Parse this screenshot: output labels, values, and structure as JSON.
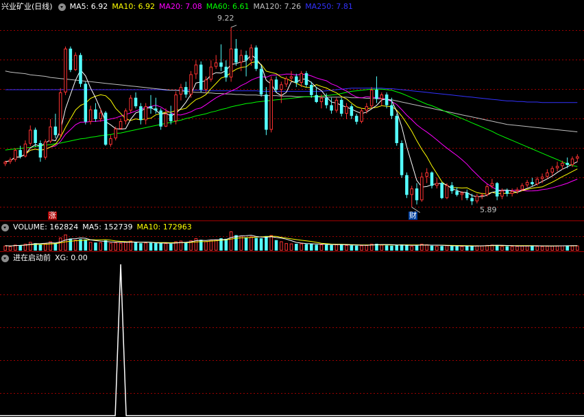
{
  "main_header": {
    "stock_name": "兴业矿业(日线)",
    "ma5": "MA5: 6.92",
    "ma10": "MA10: 6.92",
    "ma20": "MA20: 7.08",
    "ma60": "MA60: 6.61",
    "ma120": "MA120: 7.26",
    "ma250": "MA250: 7.81"
  },
  "vol_header": {
    "volume": "VOLUME: 162824",
    "ma5": "MA5: 152739",
    "ma10": "MA10: 172963"
  },
  "ind_header": {
    "name": "进在启动前",
    "xg": "XG: 0.00"
  },
  "annotations": {
    "high": "9.22",
    "low": "5.89",
    "tag_zhang": "涨",
    "tag_cai": "财"
  },
  "colors": {
    "up": "#ff3232",
    "down": "#54ffff",
    "ma5": "#ffffff",
    "ma10": "#ffff00",
    "ma20": "#ff00ff",
    "ma60": "#00ff00",
    "ma120": "#c0c0c0",
    "ma250": "#3232ff",
    "grid": "#a00000"
  },
  "chart_data": {
    "type": "candlestick",
    "ylim": [
      5.6,
      9.5
    ],
    "candles": [
      [
        6.66,
        6.72,
        6.62,
        6.7
      ],
      [
        6.7,
        6.78,
        6.66,
        6.74
      ],
      [
        6.74,
        6.95,
        6.7,
        6.92
      ],
      [
        6.92,
        7.0,
        6.76,
        6.8
      ],
      [
        6.8,
        7.1,
        6.78,
        7.04
      ],
      [
        7.04,
        7.38,
        7.0,
        7.3
      ],
      [
        7.3,
        7.34,
        6.98,
        7.05
      ],
      [
        7.05,
        7.1,
        6.7,
        6.78
      ],
      [
        6.78,
        7.12,
        6.74,
        7.08
      ],
      [
        7.08,
        7.5,
        7.05,
        7.36
      ],
      [
        7.36,
        7.6,
        7.14,
        7.2
      ],
      [
        7.2,
        8.08,
        7.15,
        8.0
      ],
      [
        8.0,
        8.86,
        7.95,
        8.82
      ],
      [
        8.82,
        8.86,
        8.38,
        8.42
      ],
      [
        8.42,
        8.75,
        8.4,
        8.7
      ],
      [
        8.7,
        8.74,
        8.1,
        8.16
      ],
      [
        8.16,
        8.2,
        7.4,
        7.45
      ],
      [
        7.45,
        7.75,
        7.4,
        7.68
      ],
      [
        7.68,
        7.8,
        7.45,
        7.5
      ],
      [
        7.5,
        7.7,
        7.45,
        7.62
      ],
      [
        7.62,
        7.65,
        7.0,
        7.02
      ],
      [
        7.02,
        7.2,
        6.98,
        7.14
      ],
      [
        7.14,
        7.36,
        7.1,
        7.32
      ],
      [
        7.32,
        7.5,
        7.3,
        7.46
      ],
      [
        7.46,
        7.7,
        7.4,
        7.66
      ],
      [
        7.66,
        7.95,
        7.62,
        7.9
      ],
      [
        7.9,
        8.0,
        7.7,
        7.74
      ],
      [
        7.74,
        7.8,
        7.4,
        7.48
      ],
      [
        7.48,
        7.8,
        7.4,
        7.74
      ],
      [
        7.74,
        7.95,
        7.6,
        7.7
      ],
      [
        7.7,
        7.9,
        7.6,
        7.66
      ],
      [
        7.66,
        7.7,
        7.3,
        7.36
      ],
      [
        7.36,
        7.7,
        7.35,
        7.6
      ],
      [
        7.6,
        7.75,
        7.4,
        7.46
      ],
      [
        7.46,
        8.02,
        7.4,
        7.96
      ],
      [
        7.96,
        8.16,
        7.85,
        8.1
      ],
      [
        8.1,
        8.2,
        7.9,
        7.96
      ],
      [
        7.96,
        8.4,
        7.9,
        8.34
      ],
      [
        8.34,
        8.6,
        8.25,
        8.52
      ],
      [
        8.52,
        8.58,
        8.0,
        8.05
      ],
      [
        8.05,
        8.3,
        8.0,
        8.24
      ],
      [
        8.24,
        8.6,
        8.2,
        8.48
      ],
      [
        8.48,
        8.7,
        8.44,
        8.56
      ],
      [
        8.56,
        8.9,
        8.4,
        8.48
      ],
      [
        8.48,
        8.6,
        8.2,
        8.28
      ],
      [
        8.28,
        9.22,
        8.2,
        8.82
      ],
      [
        8.82,
        9.0,
        8.5,
        8.56
      ],
      [
        8.56,
        8.8,
        8.4,
        8.7
      ],
      [
        8.7,
        8.78,
        8.3,
        8.6
      ],
      [
        8.6,
        8.9,
        8.5,
        8.84
      ],
      [
        8.84,
        8.88,
        8.4,
        8.44
      ],
      [
        8.44,
        8.5,
        7.92,
        7.96
      ],
      [
        7.96,
        8.1,
        7.2,
        7.3
      ],
      [
        7.3,
        8.3,
        7.25,
        8.24
      ],
      [
        8.24,
        8.3,
        8.0,
        8.05
      ],
      [
        8.05,
        8.2,
        7.8,
        8.15
      ],
      [
        8.15,
        8.3,
        8.1,
        8.26
      ],
      [
        8.26,
        8.4,
        8.2,
        8.3
      ],
      [
        8.3,
        8.35,
        8.1,
        8.18
      ],
      [
        8.18,
        8.4,
        8.1,
        8.36
      ],
      [
        8.36,
        8.4,
        8.1,
        8.14
      ],
      [
        8.14,
        8.2,
        7.9,
        7.95
      ],
      [
        7.95,
        8.1,
        7.8,
        7.82
      ],
      [
        7.82,
        7.96,
        7.7,
        7.9
      ],
      [
        7.9,
        7.98,
        7.7,
        7.76
      ],
      [
        7.76,
        7.9,
        7.6,
        7.66
      ],
      [
        7.66,
        7.9,
        7.62,
        7.86
      ],
      [
        7.86,
        7.9,
        7.55,
        7.6
      ],
      [
        7.6,
        7.8,
        7.5,
        7.74
      ],
      [
        7.74,
        7.78,
        7.5,
        7.56
      ],
      [
        7.56,
        7.6,
        7.4,
        7.45
      ],
      [
        7.45,
        7.7,
        7.42,
        7.66
      ],
      [
        7.66,
        7.8,
        7.6,
        7.74
      ],
      [
        7.74,
        8.1,
        7.7,
        8.05
      ],
      [
        8.05,
        8.3,
        7.8,
        7.88
      ],
      [
        7.88,
        8.0,
        7.75,
        7.96
      ],
      [
        7.96,
        8.0,
        7.7,
        7.76
      ],
      [
        7.76,
        7.9,
        7.5,
        7.56
      ],
      [
        7.56,
        7.6,
        7.0,
        7.05
      ],
      [
        7.05,
        7.1,
        6.4,
        6.45
      ],
      [
        6.45,
        6.5,
        6.02,
        6.08
      ],
      [
        6.08,
        6.25,
        5.85,
        6.2
      ],
      [
        6.2,
        6.3,
        5.9,
        5.98
      ],
      [
        5.98,
        6.5,
        5.95,
        6.42
      ],
      [
        6.42,
        6.58,
        6.3,
        6.5
      ],
      [
        6.5,
        6.52,
        6.2,
        6.25
      ],
      [
        6.25,
        6.4,
        6.2,
        6.3
      ],
      [
        6.3,
        6.32,
        6.0,
        6.02
      ],
      [
        6.02,
        6.3,
        6.0,
        6.26
      ],
      [
        6.26,
        6.32,
        6.1,
        6.15
      ],
      [
        6.15,
        6.22,
        6.05,
        6.08
      ],
      [
        6.08,
        6.15,
        5.98,
        6.12
      ],
      [
        6.12,
        6.18,
        5.98,
        6.02
      ],
      [
        6.02,
        6.1,
        5.89,
        5.96
      ],
      [
        5.96,
        6.1,
        5.92,
        6.06
      ],
      [
        6.06,
        6.12,
        6.0,
        6.08
      ],
      [
        6.08,
        6.28,
        6.05,
        6.24
      ],
      [
        6.24,
        6.38,
        6.2,
        6.3
      ],
      [
        6.3,
        6.32,
        5.98,
        6.05
      ],
      [
        6.05,
        6.2,
        6.0,
        6.16
      ],
      [
        6.16,
        6.2,
        6.05,
        6.1
      ],
      [
        6.1,
        6.2,
        6.05,
        6.15
      ],
      [
        6.15,
        6.22,
        6.1,
        6.18
      ],
      [
        6.18,
        6.3,
        6.15,
        6.26
      ],
      [
        6.26,
        6.36,
        6.22,
        6.32
      ],
      [
        6.32,
        6.4,
        6.25,
        6.28
      ],
      [
        6.28,
        6.42,
        6.25,
        6.38
      ],
      [
        6.38,
        6.48,
        6.3,
        6.42
      ],
      [
        6.42,
        6.56,
        6.38,
        6.5
      ],
      [
        6.5,
        6.62,
        6.44,
        6.58
      ],
      [
        6.58,
        6.7,
        6.52,
        6.62
      ],
      [
        6.62,
        6.72,
        6.55,
        6.68
      ],
      [
        6.68,
        6.78,
        6.58,
        6.64
      ],
      [
        6.64,
        6.8,
        6.6,
        6.76
      ],
      [
        6.76,
        6.84,
        6.7,
        6.8
      ]
    ],
    "ma60_series": [
      6.92,
      6.93,
      6.94,
      6.95,
      6.96,
      6.97,
      6.98,
      7.0,
      7.01,
      7.02,
      7.04,
      7.05,
      7.07,
      7.09,
      7.11,
      7.13,
      7.14,
      7.16,
      7.17,
      7.19,
      7.2,
      7.21,
      7.23,
      7.24,
      7.26,
      7.28,
      7.3,
      7.32,
      7.34,
      7.36,
      7.38,
      7.4,
      7.42,
      7.44,
      7.46,
      7.48,
      7.51,
      7.53,
      7.56,
      7.58,
      7.6,
      7.63,
      7.65,
      7.68,
      7.7,
      7.73,
      7.75,
      7.77,
      7.79,
      7.8,
      7.82,
      7.83,
      7.84,
      7.85,
      7.86,
      7.87,
      7.88,
      7.89,
      7.9,
      7.91,
      7.92,
      7.92,
      7.93,
      7.93,
      7.94,
      7.95,
      7.96,
      7.98,
      8.0,
      8.02,
      8.03,
      8.04,
      8.05,
      8.06,
      8.06,
      8.06,
      8.05,
      8.04,
      8.01,
      7.98,
      7.94,
      7.9,
      7.86,
      7.82,
      7.78,
      7.75,
      7.71,
      7.67,
      7.63,
      7.59,
      7.55,
      7.51,
      7.47,
      7.43,
      7.39,
      7.35,
      7.31,
      7.27,
      7.22,
      7.18,
      7.14,
      7.1,
      7.06,
      7.02,
      6.98,
      6.94,
      6.9,
      6.86,
      6.82,
      6.78,
      6.74,
      6.7,
      6.66,
      6.63,
      6.61
    ],
    "ma120_series": [
      8.4,
      8.38,
      8.37,
      8.36,
      8.35,
      8.33,
      8.32,
      8.31,
      8.3,
      8.28,
      8.27,
      8.26,
      8.25,
      8.24,
      8.23,
      8.22,
      8.21,
      8.2,
      8.19,
      8.18,
      8.17,
      8.16,
      8.15,
      8.14,
      8.13,
      8.12,
      8.11,
      8.1,
      8.09,
      8.08,
      8.07,
      8.06,
      8.05,
      8.04,
      8.04,
      8.03,
      8.02,
      8.01,
      8.0,
      8.0,
      7.99,
      7.99,
      7.98,
      7.98,
      7.97,
      7.97,
      7.96,
      7.96,
      7.95,
      7.95,
      7.95,
      7.94,
      7.94,
      7.94,
      7.94,
      7.93,
      7.93,
      7.93,
      7.92,
      7.92,
      7.92,
      7.92,
      7.92,
      7.91,
      7.91,
      7.91,
      7.91,
      7.91,
      7.91,
      7.9,
      7.9,
      7.9,
      7.89,
      7.89,
      7.88,
      7.88,
      7.87,
      7.86,
      7.84,
      7.82,
      7.8,
      7.78,
      7.76,
      7.74,
      7.72,
      7.7,
      7.68,
      7.66,
      7.64,
      7.62,
      7.6,
      7.58,
      7.56,
      7.54,
      7.52,
      7.5,
      7.48,
      7.46,
      7.44,
      7.42,
      7.4,
      7.39,
      7.38,
      7.37,
      7.36,
      7.35,
      7.34,
      7.33,
      7.32,
      7.31,
      7.3,
      7.29,
      7.28,
      7.27,
      7.26
    ],
    "ma250_series": [
      8.05,
      8.05,
      8.05,
      8.05,
      8.05,
      8.05,
      8.05,
      8.05,
      8.05,
      8.05,
      8.05,
      8.05,
      8.05,
      8.05,
      8.05,
      8.05,
      8.05,
      8.05,
      8.05,
      8.05,
      8.05,
      8.05,
      8.05,
      8.05,
      8.05,
      8.05,
      8.05,
      8.05,
      8.05,
      8.05,
      8.05,
      8.05,
      8.04,
      8.04,
      8.04,
      8.04,
      8.04,
      8.04,
      8.04,
      8.04,
      8.03,
      8.03,
      8.03,
      8.03,
      8.03,
      8.03,
      8.03,
      8.03,
      8.03,
      8.03,
      8.03,
      8.02,
      8.02,
      8.02,
      8.02,
      8.02,
      8.02,
      8.02,
      8.02,
      8.02,
      8.02,
      8.02,
      8.02,
      8.02,
      8.03,
      8.04,
      8.05,
      8.06,
      8.07,
      8.08,
      8.08,
      8.08,
      8.08,
      8.08,
      8.08,
      8.08,
      8.07,
      8.07,
      8.06,
      8.05,
      8.04,
      8.03,
      8.02,
      8.01,
      8.0,
      7.99,
      7.98,
      7.97,
      7.96,
      7.95,
      7.94,
      7.93,
      7.92,
      7.91,
      7.9,
      7.89,
      7.88,
      7.87,
      7.86,
      7.85,
      7.84,
      7.84,
      7.83,
      7.83,
      7.82,
      7.82,
      7.82,
      7.81,
      7.81,
      7.81,
      7.81,
      7.81,
      7.81,
      7.81,
      7.81
    ],
    "volumes": [
      80,
      70,
      95,
      90,
      110,
      140,
      120,
      105,
      115,
      150,
      125,
      210,
      260,
      195,
      175,
      185,
      180,
      140,
      130,
      135,
      165,
      125,
      130,
      125,
      140,
      160,
      135,
      120,
      130,
      125,
      120,
      115,
      120,
      110,
      150,
      160,
      130,
      165,
      200,
      175,
      150,
      175,
      180,
      200,
      190,
      310,
      250,
      240,
      215,
      230,
      205,
      200,
      235,
      250,
      170,
      150,
      120,
      115,
      110,
      115,
      105,
      110,
      95,
      100,
      95,
      90,
      100,
      95,
      90,
      85,
      80,
      85,
      90,
      110,
      110,
      95,
      85,
      80,
      90,
      100,
      85,
      75,
      80,
      110,
      100,
      80,
      75,
      75,
      85,
      75,
      70,
      72,
      70,
      80,
      85,
      80,
      90,
      95,
      85,
      75,
      70,
      72,
      75,
      78,
      80,
      78,
      75,
      72,
      76,
      78,
      80,
      82,
      78,
      80,
      82
    ],
    "xg_signal": {
      "index": 23,
      "value": 1,
      "baseline": 0
    }
  }
}
